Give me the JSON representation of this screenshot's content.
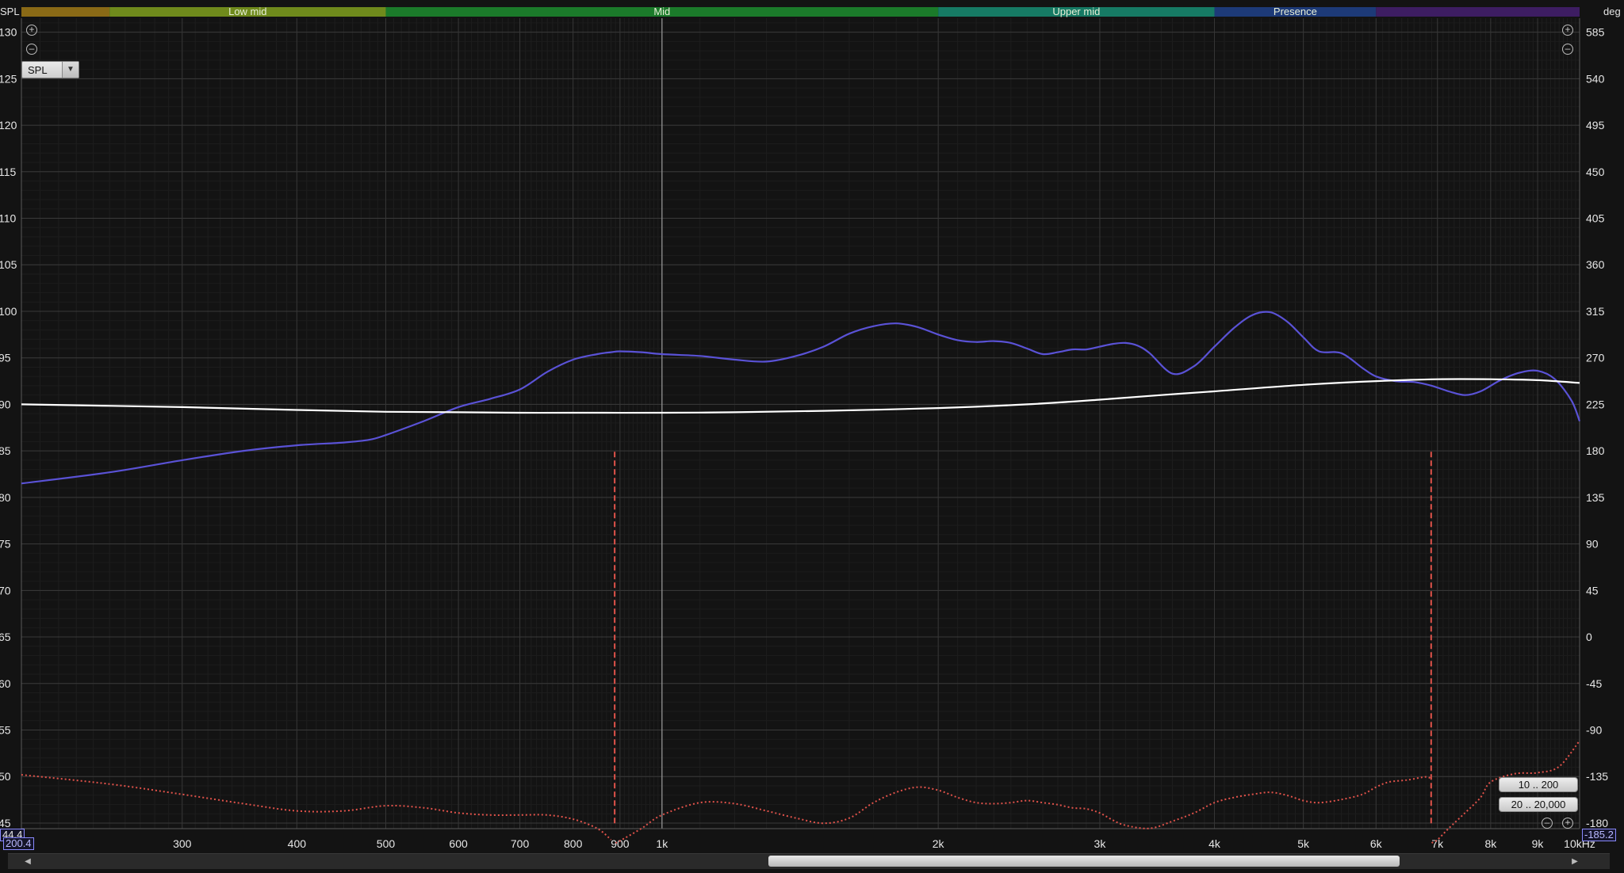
{
  "window": {
    "left_axis_unit": "SPL",
    "right_axis_unit": "deg"
  },
  "bands": [
    {
      "name": "",
      "from": 200,
      "to": 250,
      "color": "#8a6a16"
    },
    {
      "name": "Low mid",
      "from": 250,
      "to": 500,
      "color": "#6f8a1c"
    },
    {
      "name": "Mid",
      "from": 500,
      "to": 2000,
      "color": "#1b7a2a"
    },
    {
      "name": "Upper mid",
      "from": 2000,
      "to": 4000,
      "color": "#167a64"
    },
    {
      "name": "Presence",
      "from": 4000,
      "to": 6000,
      "color": "#1d3a78"
    },
    {
      "name": "",
      "from": 6000,
      "to": 10000,
      "color": "#3d1d62"
    }
  ],
  "controls": {
    "spl_dropdown": "SPL",
    "range_button_1": "10 .. 200",
    "range_button_2": "20 .. 20,000"
  },
  "cursor": {
    "left_value_top": "44.4",
    "left_value_bottom": "200.4",
    "right_value": "-185.2"
  },
  "chart_data": {
    "type": "line",
    "xscale": "log",
    "xlim": [
      200.4,
      10000
    ],
    "ylim": [
      44.4,
      131.5
    ],
    "y2lim": [
      -185.2,
      600
    ],
    "x_ticks": [
      {
        "v": 300,
        "label": "300"
      },
      {
        "v": 400,
        "label": "400"
      },
      {
        "v": 500,
        "label": "500"
      },
      {
        "v": 600,
        "label": "600"
      },
      {
        "v": 700,
        "label": "700"
      },
      {
        "v": 800,
        "label": "800"
      },
      {
        "v": 900,
        "label": "900"
      },
      {
        "v": 1000,
        "label": "1k"
      },
      {
        "v": 2000,
        "label": "2k"
      },
      {
        "v": 3000,
        "label": "3k"
      },
      {
        "v": 4000,
        "label": "4k"
      },
      {
        "v": 5000,
        "label": "5k"
      },
      {
        "v": 6000,
        "label": "6k"
      },
      {
        "v": 7000,
        "label": "7k"
      },
      {
        "v": 8000,
        "label": "8k"
      },
      {
        "v": 9000,
        "label": "9k"
      },
      {
        "v": 10000,
        "label": "10kHz"
      }
    ],
    "y_ticks": [
      "130",
      "125",
      "120",
      "115",
      "110",
      "105",
      "100",
      "95",
      "90",
      "85",
      "80",
      "75",
      "70",
      "65",
      "60",
      "55",
      "50",
      "45"
    ],
    "y_tick_values": [
      130,
      125,
      120,
      115,
      110,
      105,
      100,
      95,
      90,
      85,
      80,
      75,
      70,
      65,
      60,
      55,
      50,
      45
    ],
    "y2_ticks": [
      "585",
      "540",
      "495",
      "450",
      "405",
      "360",
      "315",
      "270",
      "225",
      "180",
      "135",
      "90",
      "45",
      "0",
      "-45",
      "-90",
      "-135",
      "-180"
    ],
    "grid": true,
    "series": [
      {
        "style": "solid",
        "color": "#5a52d6",
        "axis": "left",
        "x": [
          200.4,
          250,
          300,
          350,
          400,
          450,
          480,
          500,
          550,
          600,
          650,
          700,
          750,
          800,
          850,
          880,
          900,
          950,
          1000,
          1100,
          1200,
          1300,
          1400,
          1500,
          1600,
          1700,
          1800,
          1900,
          2000,
          2100,
          2200,
          2300,
          2400,
          2500,
          2600,
          2700,
          2800,
          2900,
          3000,
          3100,
          3200,
          3300,
          3400,
          3600,
          3800,
          4000,
          4200,
          4400,
          4600,
          4800,
          5000,
          5200,
          5500,
          5800,
          6000,
          6300,
          6600,
          6900,
          7200,
          7500,
          7800,
          8200,
          8600,
          9000,
          9400,
          9800,
          10000
        ],
        "y": [
          81.5,
          82.7,
          84,
          85,
          85.6,
          85.9,
          86.2,
          86.7,
          88.2,
          89.7,
          90.6,
          91.6,
          93.5,
          94.8,
          95.4,
          95.6,
          95.7,
          95.6,
          95.4,
          95.2,
          94.8,
          94.6,
          95.2,
          96.2,
          97.6,
          98.4,
          98.7,
          98.3,
          97.5,
          96.9,
          96.7,
          96.8,
          96.6,
          96,
          95.4,
          95.6,
          95.9,
          95.9,
          96.2,
          96.5,
          96.6,
          96.3,
          95.5,
          93.3,
          94.1,
          96.2,
          98.2,
          99.6,
          99.9,
          98.9,
          97.2,
          95.7,
          95.5,
          93.9,
          93,
          92.5,
          92.4,
          92,
          91.4,
          91.0,
          91.4,
          92.6,
          93.4,
          93.6,
          92.7,
          90.4,
          88.2
        ]
      },
      {
        "style": "solid",
        "color": "#ffffff",
        "axis": "left",
        "x": [
          200.4,
          300,
          400,
          500,
          600,
          700,
          800,
          1000,
          1200,
          1500,
          2000,
          2500,
          3000,
          3500,
          4000,
          5000,
          6000,
          7000,
          8000,
          9000,
          10000
        ],
        "y": [
          90,
          89.7,
          89.4,
          89.2,
          89.15,
          89.1,
          89.1,
          89.1,
          89.15,
          89.3,
          89.6,
          90,
          90.5,
          91,
          91.4,
          92.1,
          92.5,
          92.7,
          92.7,
          92.6,
          92.3
        ]
      },
      {
        "style": "dotted",
        "color": "#e0524a",
        "axis": "right",
        "x": [
          200.4,
          250,
          300,
          350,
          400,
          450,
          500,
          550,
          600,
          650,
          700,
          750,
          800,
          850,
          880,
          890,
          900,
          950,
          1000,
          1100,
          1200,
          1300,
          1400,
          1500,
          1600,
          1700,
          1800,
          1900,
          2000,
          2100,
          2200,
          2300,
          2400,
          2500,
          2600,
          2700,
          2800,
          2900,
          3000,
          3100,
          3200,
          3400,
          3600,
          3800,
          4000,
          4200,
          4400,
          4600,
          4800,
          5000,
          5200,
          5500,
          5800,
          6000,
          6200,
          6500,
          6800,
          6880,
          6900,
          7000,
          7200,
          7500,
          7800,
          8000,
          8500,
          9000,
          9500,
          10000
        ],
        "y": [
          -133,
          -142,
          -152,
          -161,
          -168,
          -168,
          -163,
          -165,
          -170,
          -172,
          -172,
          -172,
          -176,
          -185,
          -196,
          -199,
          -197,
          -185,
          -172,
          -160,
          -161,
          -168,
          -175,
          -180,
          -175,
          -160,
          -150,
          -145,
          -148,
          -155,
          -160,
          -161,
          -160,
          -158,
          -160,
          -162,
          -165,
          -166,
          -170,
          -177,
          -182,
          -185,
          -178,
          -170,
          -160,
          -155,
          -152,
          -150,
          -153,
          -158,
          -160,
          -157,
          -152,
          -145,
          -140,
          -138,
          -135,
          -137,
          -199,
          -196,
          -185,
          -170,
          -155,
          -140,
          -132,
          -131,
          -125,
          -100
        ],
        "y_display": "wrapped"
      }
    ],
    "annotations": [
      {
        "type": "wrap",
        "x": 888
      },
      {
        "type": "wrap",
        "x": 6890
      },
      {
        "type": "cursor_line",
        "x": 1000
      }
    ]
  }
}
